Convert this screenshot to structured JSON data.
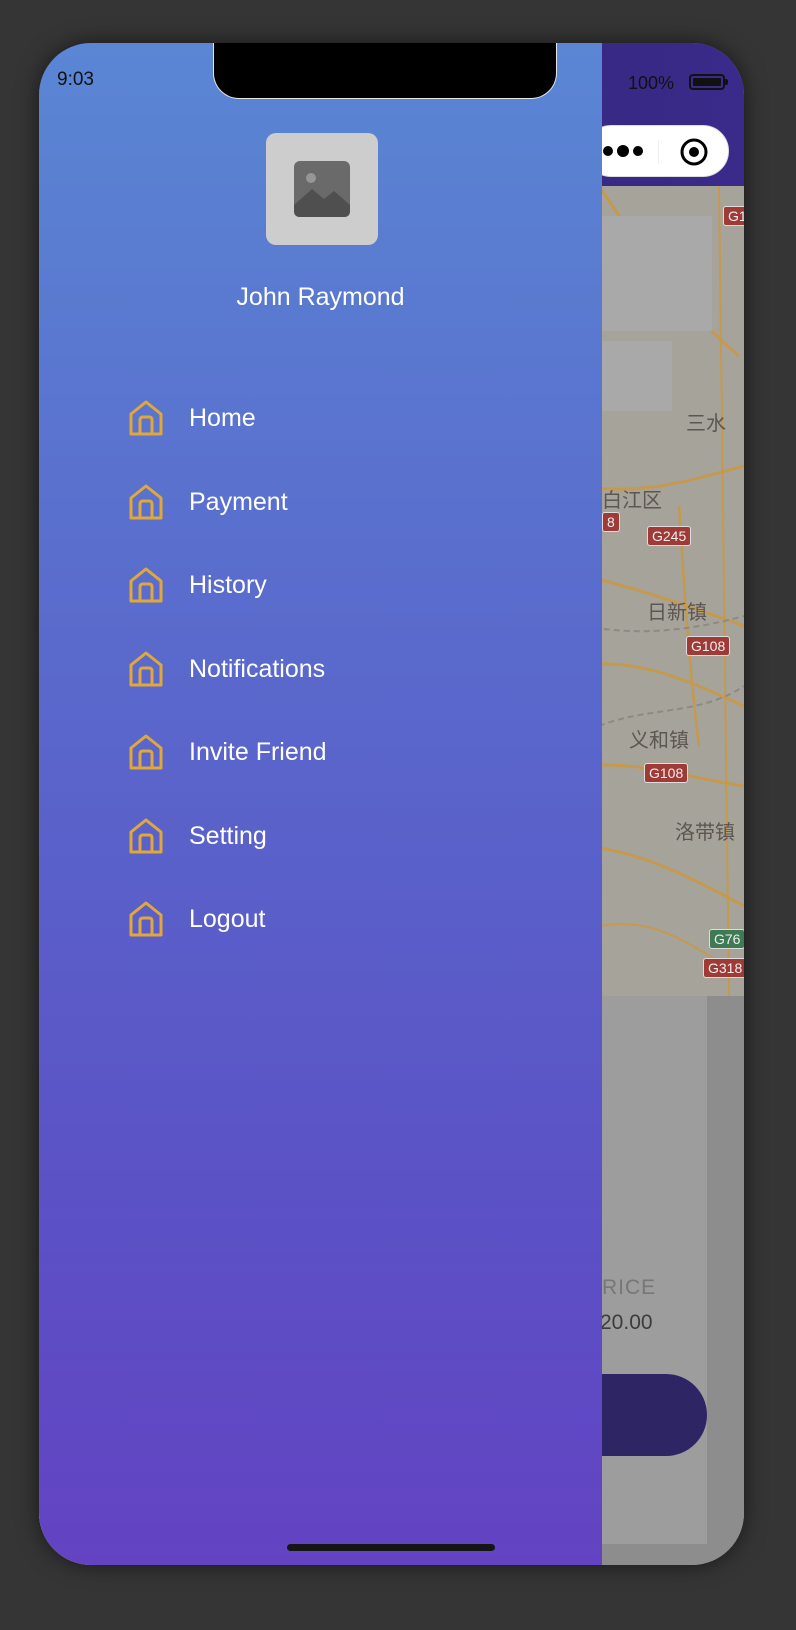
{
  "status_bar": {
    "time": "9:03",
    "battery": "100%"
  },
  "user": {
    "name": "John Raymond"
  },
  "menu": {
    "items": [
      {
        "label": "Home",
        "icon": "home-icon"
      },
      {
        "label": "Payment",
        "icon": "home-icon"
      },
      {
        "label": "History",
        "icon": "home-icon"
      },
      {
        "label": "Notifications",
        "icon": "home-icon"
      },
      {
        "label": "Invite Friend",
        "icon": "home-icon"
      },
      {
        "label": "Setting",
        "icon": "home-icon"
      },
      {
        "label": "Logout",
        "icon": "home-icon"
      }
    ]
  },
  "map": {
    "places": [
      "白江区",
      "日新镇",
      "义和镇",
      "洛带镇",
      "三水"
    ],
    "roads": [
      "G245",
      "G108",
      "G108",
      "G76",
      "G318",
      "G1",
      "8"
    ]
  },
  "background_panel": {
    "price_label": "RICE",
    "price_value": "20.00"
  },
  "colors": {
    "drawer_top": "#5a86d4",
    "drawer_bottom": "#6343c2",
    "icon_accent": "#e0a83a"
  }
}
